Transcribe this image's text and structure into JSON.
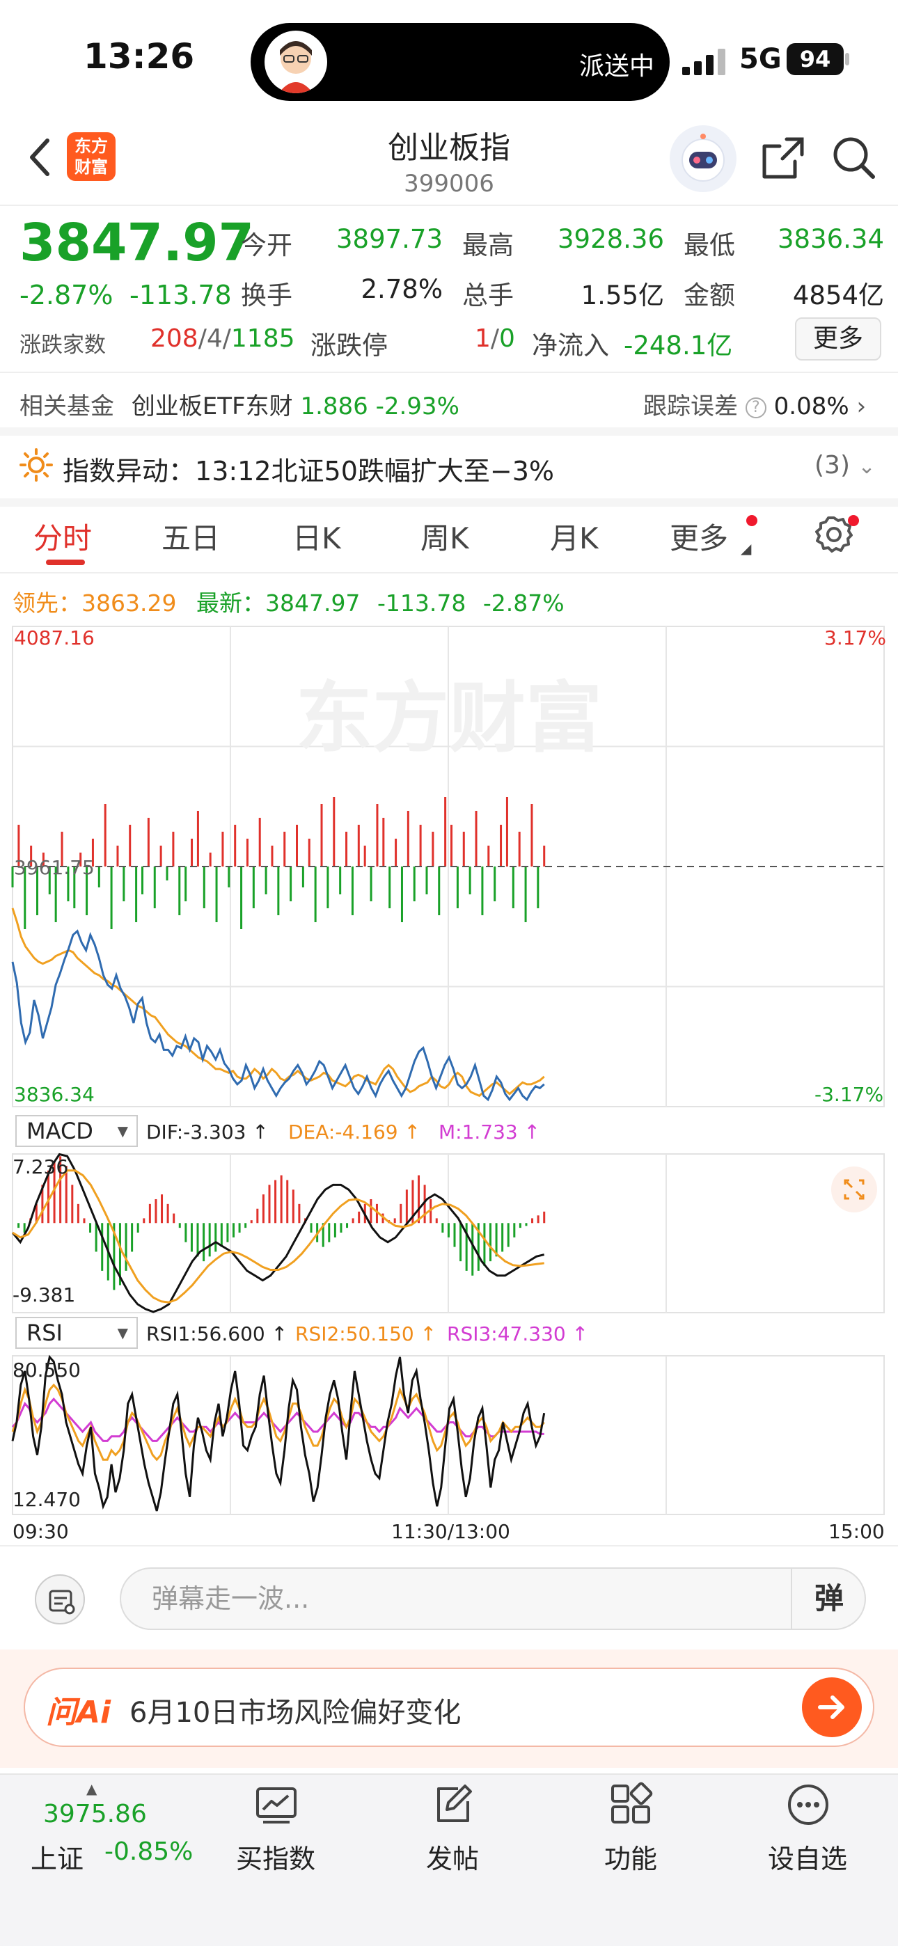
{
  "status": {
    "time": "13:26",
    "island_text": "派送中",
    "network": "5G",
    "battery": "94"
  },
  "header": {
    "logo_text": "东方财富",
    "title": "创业板指",
    "code": "399006"
  },
  "quote": {
    "price": "3847.97",
    "change_pct": "-2.87%",
    "change": "-113.78",
    "rows": [
      [
        {
          "label": "今开",
          "value": "3897.73"
        },
        {
          "label": "最高",
          "value": "3928.36"
        },
        {
          "label": "最低",
          "value": "3836.34"
        }
      ],
      [
        {
          "label": "换手",
          "value": "2.78%"
        },
        {
          "label": "总手",
          "value": "1.55亿"
        },
        {
          "label": "金额",
          "value": "4854亿"
        }
      ]
    ],
    "breadth_label": "涨跌家数",
    "breadth_up": "208",
    "breadth_flat": "4",
    "breadth_down": "1185",
    "limit_label": "涨跌停",
    "limit_up": "1",
    "limit_down": "0",
    "netflow_label": "净流入",
    "netflow_value": "-248.1亿",
    "more_button": "更多"
  },
  "fund": {
    "label": "相关基金",
    "name": "创业板ETF东财",
    "price": "1.886",
    "change": "-2.93%",
    "tracking_label": "跟踪误差",
    "tracking_value": "0.08%"
  },
  "alert": {
    "label": "指数异动：",
    "text": "13:12北证50跌幅扩大至−3%",
    "count": "(3)"
  },
  "tabs": [
    "分时",
    "五日",
    "日K",
    "周K",
    "月K",
    "更多"
  ],
  "chart_info": {
    "lead_label": "领先：",
    "lead_value": "3863.29",
    "latest_label": "最新：",
    "latest_value": "3847.97",
    "latest_change": "-113.78",
    "latest_pct": "-2.87%"
  },
  "watermark": "东方财富",
  "chart_data": {
    "type": "line",
    "main": {
      "y_top": "4087.16",
      "y_mid": "3961.75",
      "y_bottom": "3836.34",
      "pct_top": "3.17%",
      "pct_bottom": "-3.17%",
      "ylim": [
        3836.34,
        4087.16
      ],
      "prev_close": 3961.75,
      "price": [
        3912,
        3901,
        3880,
        3870,
        3875,
        3892,
        3884,
        3872,
        3880,
        3888,
        3900,
        3906,
        3913,
        3919,
        3926,
        3928,
        3922,
        3918,
        3926,
        3921,
        3914,
        3905,
        3900,
        3898,
        3905,
        3898,
        3894,
        3888,
        3880,
        3890,
        3893,
        3880,
        3872,
        3870,
        3874,
        3866,
        3866,
        3863,
        3868,
        3867,
        3873,
        3866,
        3872,
        3870,
        3861,
        3868,
        3865,
        3861,
        3866,
        3859,
        3856,
        3851,
        3848,
        3850,
        3858,
        3853,
        3846,
        3850,
        3856,
        3850,
        3846,
        3842,
        3846,
        3849,
        3851,
        3855,
        3858,
        3854,
        3848,
        3851,
        3855,
        3860,
        3858,
        3852,
        3846,
        3850,
        3854,
        3858,
        3852,
        3846,
        3843,
        3847,
        3852,
        3846,
        3842,
        3848,
        3852,
        3855,
        3850,
        3846,
        3842,
        3846,
        3853,
        3860,
        3865,
        3867,
        3860,
        3852,
        3846,
        3852,
        3858,
        3862,
        3856,
        3848,
        3846,
        3848,
        3852,
        3858,
        3850,
        3842,
        3840,
        3845,
        3852,
        3849,
        3843,
        3840,
        3843,
        3846,
        3842,
        3840,
        3844,
        3847,
        3846,
        3848
      ],
      "avg": [
        3940,
        3933,
        3925,
        3920,
        3917,
        3914,
        3912,
        3911,
        3912,
        3913,
        3915,
        3916,
        3917,
        3918,
        3917,
        3914,
        3912,
        3910,
        3908,
        3906,
        3905,
        3903,
        3902,
        3900,
        3899,
        3897,
        3895,
        3893,
        3891,
        3889,
        3888,
        3886,
        3884,
        3883,
        3880,
        3877,
        3874,
        3872,
        3870,
        3869,
        3868,
        3866,
        3864,
        3862,
        3861,
        3860,
        3858,
        3856,
        3856,
        3855,
        3854,
        3855,
        3852,
        3851,
        3851,
        3853,
        3856,
        3854,
        3851,
        3853,
        3856,
        3854,
        3851,
        3850,
        3852,
        3853,
        3855,
        3853,
        3851,
        3850,
        3851,
        3852,
        3854,
        3853,
        3850,
        3849,
        3848,
        3847,
        3849,
        3852,
        3853,
        3852,
        3850,
        3849,
        3848,
        3852,
        3856,
        3858,
        3856,
        3852,
        3849,
        3846,
        3844,
        3845,
        3847,
        3848,
        3849,
        3852,
        3850,
        3847,
        3846,
        3848,
        3852,
        3854,
        3852,
        3847,
        3844,
        3843,
        3842,
        3844,
        3846,
        3848,
        3849,
        3847,
        3845,
        3843,
        3845,
        3847,
        3849,
        3848,
        3848,
        3849,
        3850,
        3852
      ],
      "breadth_bars": [
        -0.3,
        0.6,
        -0.9,
        0.3,
        -0.7,
        0.2,
        -0.4,
        -0.8,
        0.5,
        -0.5,
        -0.6,
        0.2,
        -0.7,
        0.4,
        -0.3,
        0.9,
        -0.9,
        0.3,
        -0.5,
        0.6,
        -0.8,
        -0.4,
        0.7,
        -0.6,
        0.3,
        -0.2,
        0.5,
        -0.7,
        -0.5,
        0.4,
        0.8,
        -0.6,
        0.2,
        -0.8,
        0.5,
        -0.3,
        0.6,
        -0.9,
        0.4,
        -0.6,
        0.7,
        -0.4,
        0.3,
        -0.7,
        0.5,
        -0.5,
        0.6,
        -0.3,
        0.4,
        -0.8,
        0.9,
        -0.6,
        1.0,
        -0.4,
        0.5,
        -0.7,
        0.6,
        0.3,
        -0.5,
        0.9,
        0.7,
        -0.6,
        0.4,
        -0.8,
        0.8,
        -0.5,
        0.6,
        -0.4,
        0.5,
        -0.7,
        1.0,
        0.6,
        -0.6,
        0.5,
        -0.4,
        0.8,
        -0.7,
        0.3,
        -0.5,
        0.6,
        1.0,
        -0.6,
        0.5,
        -0.8,
        0.9,
        -0.6,
        0.3
      ]
    },
    "macd": {
      "indicator": "MACD",
      "dif_label": "DIF:-3.303 ↑",
      "dea_label": "DEA:-4.169 ↑",
      "m_label": "M:1.733 ↑",
      "y_top": "7.236",
      "y_bottom": "-9.381",
      "ylim": [
        -9.381,
        7.236
      ],
      "hist": [
        0,
        -0.5,
        -1.0,
        0.5,
        2,
        4,
        5.5,
        6.5,
        7,
        6,
        4,
        2,
        0.5,
        -1,
        -3,
        -5,
        -6,
        -7,
        -6.5,
        -5,
        -3,
        -1,
        0.5,
        2,
        2.5,
        3,
        2,
        1,
        -0.5,
        -2,
        -3,
        -3.5,
        -4,
        -3.5,
        -3,
        -2.5,
        -2,
        -1.5,
        -1,
        -0.5,
        0.3,
        1.5,
        3,
        4,
        4.5,
        5,
        4.5,
        3.5,
        2,
        0.5,
        -1,
        -2,
        -2.5,
        -2,
        -1.5,
        -1,
        -0.5,
        0.5,
        1.2,
        2,
        2.5,
        2,
        1,
        0.3,
        0.5,
        2,
        3.5,
        4.5,
        5,
        4,
        2.5,
        0.5,
        -1,
        -1.5,
        -2.5,
        -4,
        -5,
        -5.5,
        -5,
        -4.5,
        -4,
        -3.5,
        -3,
        -2.5,
        -1.5,
        -0.5,
        -0.3,
        0.5,
        0.8,
        1.2
      ],
      "dif": [
        -1,
        -2,
        -0.5,
        2,
        4,
        6,
        7.2,
        7,
        5.5,
        3.5,
        1.5,
        -0.5,
        -2.5,
        -4.5,
        -6,
        -7.5,
        -8.5,
        -9,
        -9.3,
        -9,
        -8.5,
        -7,
        -5.5,
        -4,
        -3,
        -2.5,
        -2,
        -2.5,
        -3,
        -4,
        -5,
        -5.5,
        -6,
        -5.5,
        -4.5,
        -3.5,
        -2,
        -0.5,
        1,
        2.5,
        3.5,
        4,
        4,
        3.5,
        2.5,
        1,
        -0.5,
        -1.5,
        -2,
        -1.5,
        -0.5,
        0.5,
        1.5,
        2.5,
        3,
        2.5,
        1.5,
        0.5,
        -1,
        -2.5,
        -4,
        -5,
        -5.5,
        -5.5,
        -5,
        -4.5,
        -4,
        -3.5,
        -3.3
      ],
      "dea": [
        -1,
        -1.5,
        -1.2,
        0,
        1.5,
        3,
        4.5,
        5.5,
        5.5,
        5,
        4,
        2.5,
        0.8,
        -1,
        -3,
        -4.5,
        -6,
        -7,
        -7.8,
        -8.2,
        -8.3,
        -8,
        -7.3,
        -6.5,
        -5.5,
        -4.5,
        -3.8,
        -3.2,
        -3,
        -3.2,
        -3.6,
        -4.1,
        -4.6,
        -4.9,
        -4.9,
        -4.6,
        -4,
        -3.2,
        -2.2,
        -1.1,
        0,
        1,
        1.8,
        2.4,
        2.5,
        2.2,
        1.6,
        0.9,
        0.2,
        -0.3,
        -0.4,
        -0.2,
        0.4,
        1.1,
        1.7,
        2,
        1.9,
        1.5,
        0.8,
        -0.2,
        -1.3,
        -2.4,
        -3.3,
        -4,
        -4.4,
        -4.5,
        -4.4,
        -4.3,
        -4.2
      ]
    },
    "rsi": {
      "indicator": "RSI",
      "rsi1_label": "RSI1:56.600 ↑",
      "rsi2_label": "RSI2:50.150 ↑",
      "rsi3_label": "RSI3:47.330 ↑",
      "y_top": "80.550",
      "y_bottom": "12.470",
      "ylim": [
        12.47,
        80.55
      ],
      "rsi1": [
        44,
        52,
        68,
        74,
        62,
        46,
        38,
        50,
        72,
        80,
        78,
        70,
        64,
        52,
        46,
        40,
        34,
        30,
        42,
        50,
        30,
        24,
        16,
        20,
        34,
        22,
        28,
        40,
        60,
        64,
        54,
        44,
        34,
        26,
        20,
        14,
        22,
        36,
        48,
        60,
        64,
        48,
        30,
        20,
        42,
        54,
        48,
        40,
        36,
        52,
        60,
        46,
        54,
        66,
        74,
        60,
        42,
        40,
        46,
        50,
        64,
        72,
        56,
        42,
        30,
        26,
        40,
        58,
        70,
        66,
        50,
        38,
        30,
        18,
        24,
        38,
        54,
        64,
        70,
        62,
        48,
        36,
        56,
        74,
        64,
        54,
        44,
        36,
        30,
        28,
        40,
        52,
        60,
        72,
        80,
        64,
        56,
        70,
        74,
        62,
        52,
        40,
        26,
        16,
        24,
        42,
        58,
        62,
        48,
        32,
        20,
        28,
        44,
        54,
        58,
        42,
        24,
        36,
        40,
        52,
        44,
        36,
        42,
        48,
        56,
        60,
        50,
        42,
        46,
        56
      ],
      "rsi2": [
        48,
        52,
        60,
        66,
        62,
        54,
        48,
        52,
        60,
        66,
        68,
        66,
        62,
        56,
        52,
        48,
        44,
        42,
        46,
        50,
        44,
        40,
        36,
        36,
        40,
        38,
        40,
        44,
        52,
        56,
        54,
        50,
        46,
        42,
        38,
        36,
        38,
        44,
        48,
        54,
        58,
        52,
        46,
        42,
        46,
        50,
        50,
        48,
        46,
        50,
        54,
        50,
        52,
        58,
        62,
        58,
        52,
        50,
        50,
        52,
        58,
        62,
        58,
        52,
        46,
        44,
        48,
        54,
        60,
        60,
        56,
        50,
        46,
        42,
        42,
        46,
        52,
        58,
        62,
        60,
        54,
        50,
        54,
        62,
        60,
        56,
        52,
        48,
        46,
        44,
        46,
        50,
        54,
        60,
        66,
        62,
        58,
        62,
        64,
        60,
        56,
        50,
        44,
        40,
        42,
        48,
        54,
        56,
        52,
        46,
        42,
        44,
        48,
        52,
        54,
        50,
        44,
        46,
        48,
        52,
        50,
        48,
        50,
        50,
        52,
        54,
        52,
        50,
        50,
        52
      ],
      "rsi3": [
        50,
        52,
        56,
        60,
        58,
        54,
        52,
        54,
        56,
        60,
        62,
        60,
        58,
        56,
        54,
        52,
        50,
        48,
        50,
        52,
        48,
        46,
        44,
        44,
        46,
        46,
        46,
        48,
        52,
        54,
        52,
        50,
        48,
        46,
        44,
        44,
        46,
        48,
        50,
        52,
        54,
        52,
        50,
        48,
        48,
        50,
        50,
        50,
        48,
        50,
        52,
        50,
        52,
        54,
        56,
        54,
        52,
        52,
        52,
        52,
        54,
        56,
        54,
        52,
        50,
        48,
        50,
        52,
        54,
        56,
        54,
        52,
        50,
        48,
        48,
        50,
        52,
        54,
        56,
        54,
        52,
        50,
        52,
        56,
        56,
        54,
        52,
        50,
        50,
        48,
        50,
        50,
        52,
        54,
        58,
        56,
        54,
        56,
        58,
        56,
        54,
        52,
        50,
        48,
        48,
        50,
        52,
        52,
        50,
        48,
        46,
        46,
        48,
        50,
        50,
        48,
        46,
        46,
        48,
        48,
        48,
        48,
        48,
        48,
        48,
        48,
        48,
        48,
        47,
        47
      ]
    },
    "time_labels": [
      "09:30",
      "11:30/13:00",
      "15:00"
    ]
  },
  "barrage": {
    "placeholder": "弹幕走一波...",
    "button": "弹"
  },
  "ai_banner": {
    "logo": "问Ai",
    "text": "6月10日市场风险偏好变化"
  },
  "bottom_bar": {
    "index_value": "3975.86",
    "index_name": "上证",
    "index_pct": "-0.85%",
    "items": [
      "买指数",
      "发帖",
      "功能",
      "设自选"
    ]
  },
  "colors": {
    "up": "#e0312b",
    "down": "#19a128",
    "avg": "#f0a020",
    "price_line": "#2f6bb0",
    "brand": "#ff5a1f"
  }
}
